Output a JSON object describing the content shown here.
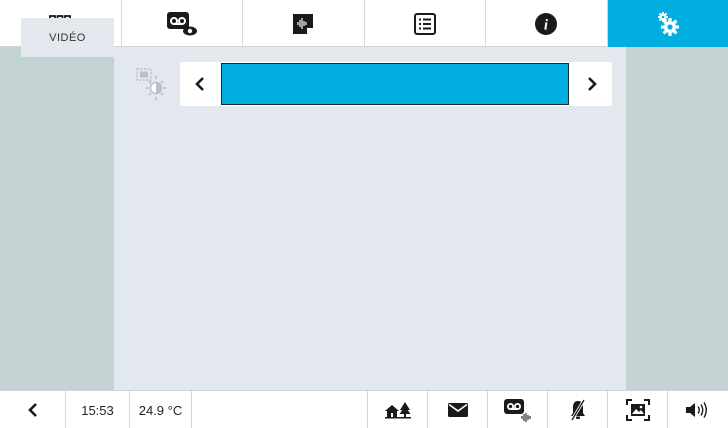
{
  "topnav": {
    "tabs": [
      {
        "icon": "apps-grid-icon"
      },
      {
        "icon": "voicemail-view-icon"
      },
      {
        "icon": "audio-message-icon"
      },
      {
        "icon": "list-icon"
      },
      {
        "icon": "info-icon"
      },
      {
        "icon": "settings-gears-icon",
        "active": true
      }
    ]
  },
  "sidebar": {
    "items": [
      {
        "label": "VIDÉO"
      }
    ]
  },
  "video_setting": {
    "icon": "brightness-contrast-icon",
    "level": 1.0
  },
  "statusbar": {
    "time": "15:53",
    "temperature": "24.9 °C",
    "icons": [
      "home-trees-icon",
      "mail-icon",
      "voicemail-audio-icon",
      "bell-muted-icon",
      "picture-frame-icon",
      "volume-icon"
    ]
  },
  "colors": {
    "accent": "#00aee0",
    "panel": "#c3d2d2",
    "content": "#e3e8ef"
  }
}
